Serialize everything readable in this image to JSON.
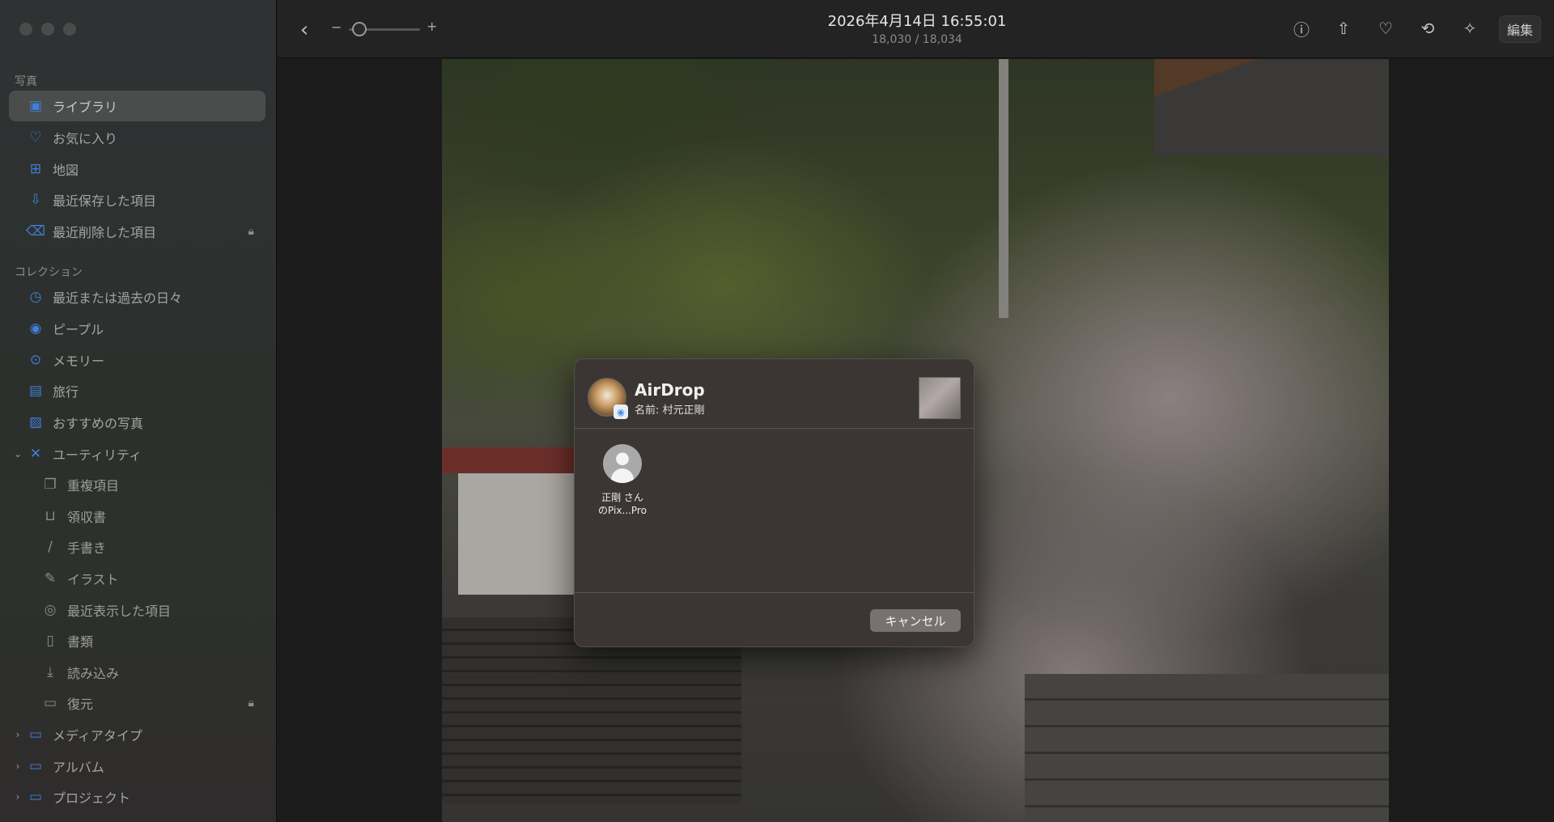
{
  "sidebar": {
    "section_photos": "写真",
    "items_photos": [
      {
        "label": "ライブラリ",
        "icon": "library-icon",
        "selected": true
      },
      {
        "label": "お気に入り",
        "icon": "heart-icon"
      },
      {
        "label": "地図",
        "icon": "map-icon"
      },
      {
        "label": "最近保存した項目",
        "icon": "recently-saved-icon"
      },
      {
        "label": "最近削除した項目",
        "icon": "trash-icon",
        "locked": true
      }
    ],
    "section_collections": "コレクション",
    "items_collections": [
      {
        "label": "最近または過去の日々",
        "icon": "clock-icon"
      },
      {
        "label": "ピープル",
        "icon": "person-icon"
      },
      {
        "label": "メモリー",
        "icon": "memories-icon"
      },
      {
        "label": "旅行",
        "icon": "suitcase-icon"
      },
      {
        "label": "おすすめの写真",
        "icon": "featured-photo-icon"
      },
      {
        "label": "ユーティリティ",
        "icon": "tools-icon",
        "expanded": true
      }
    ],
    "utility_subitems": [
      {
        "label": "重複項目",
        "icon": "duplicate-icon"
      },
      {
        "label": "領収書",
        "icon": "cart-icon"
      },
      {
        "label": "手書き",
        "icon": "pen-icon"
      },
      {
        "label": "イラスト",
        "icon": "brush-icon"
      },
      {
        "label": "最近表示した項目",
        "icon": "eye-icon"
      },
      {
        "label": "書類",
        "icon": "document-icon"
      },
      {
        "label": "読み込み",
        "icon": "import-icon"
      },
      {
        "label": "復元",
        "icon": "recover-icon",
        "locked": true
      }
    ],
    "collapsed_groups": [
      {
        "label": "メディアタイプ",
        "icon": "folder-icon"
      },
      {
        "label": "アルバム",
        "icon": "folder-icon"
      },
      {
        "label": "プロジェクト",
        "icon": "folder-icon"
      }
    ]
  },
  "toolbar": {
    "date": "2026年4月14日 16:55:01",
    "count": "18,030 / 18,034",
    "zoom_minus": "−",
    "zoom_plus": "+",
    "zoom_level": 0.15,
    "edit_label": "編集"
  },
  "airdrop": {
    "title": "AirDrop",
    "subtitle": "名前: 村元正剛",
    "recipient_line1": "正剛 さん",
    "recipient_line2": "のPix...Pro",
    "cancel_label": "キャンセル"
  }
}
